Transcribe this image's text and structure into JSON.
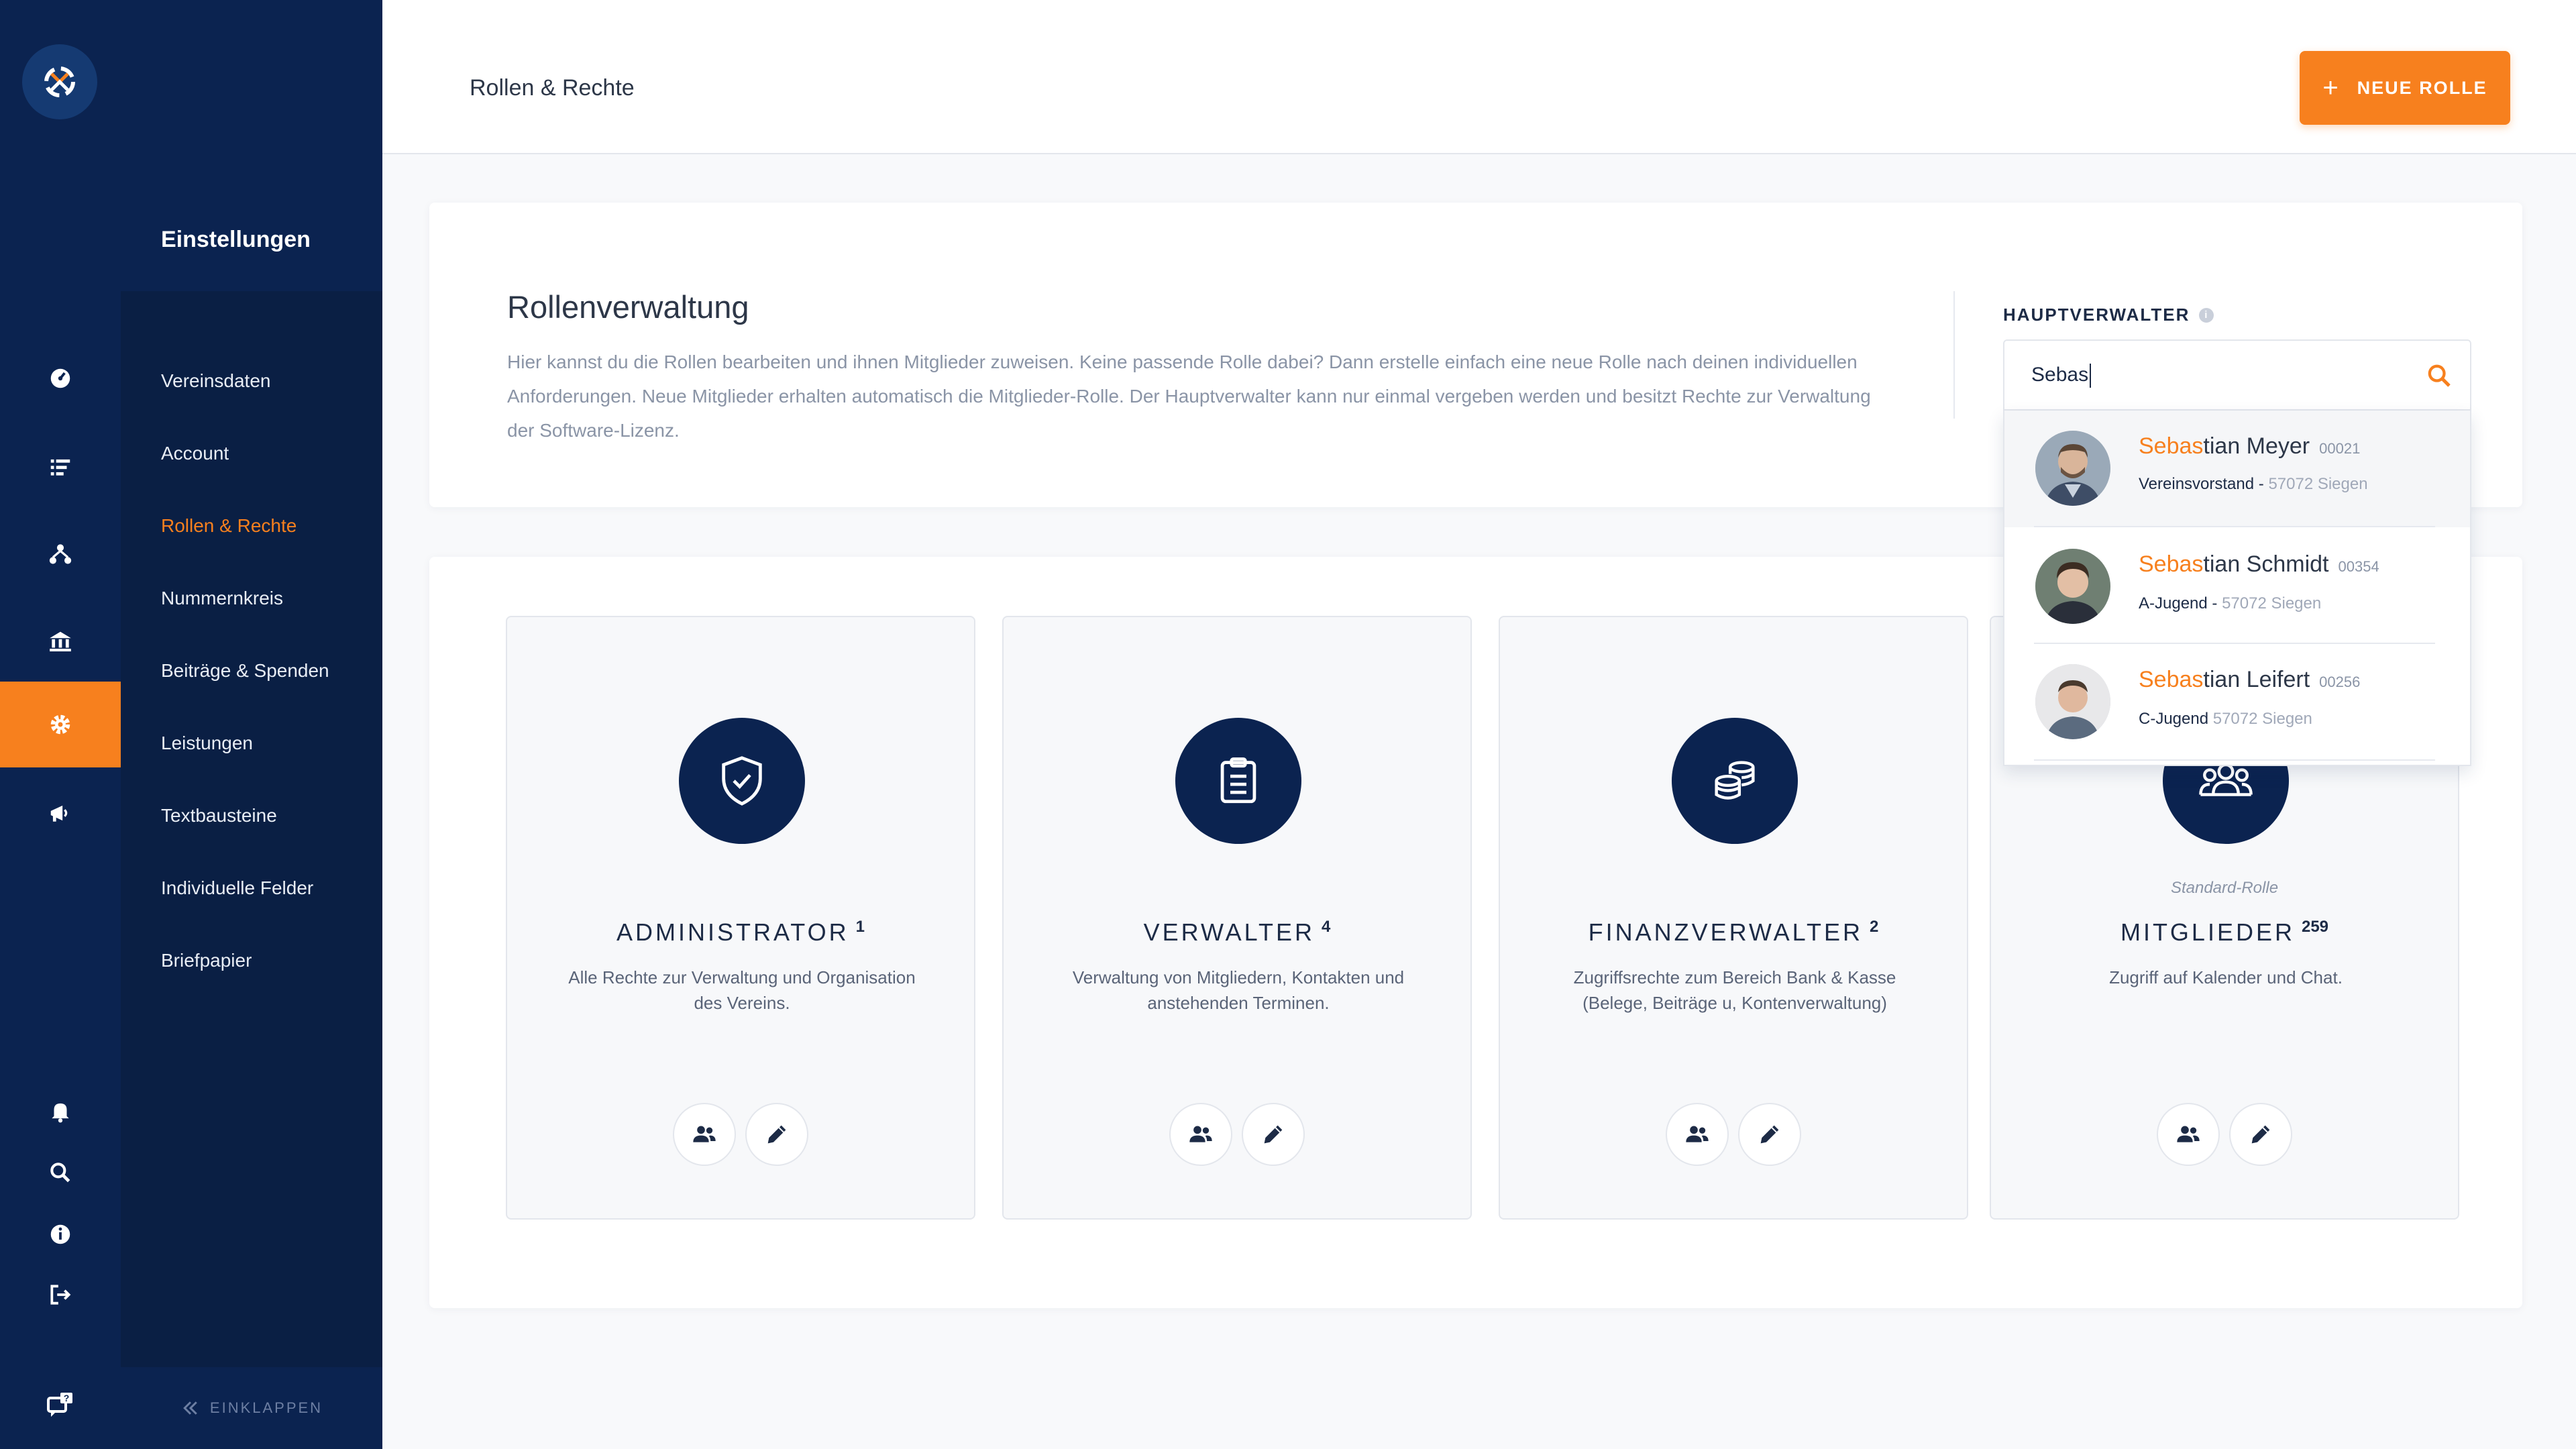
{
  "rail": {
    "logo_icon": "club-logo-icon",
    "items": [
      {
        "icon": "dashboard-icon"
      },
      {
        "icon": "list-icon"
      },
      {
        "icon": "network-icon"
      },
      {
        "icon": "bank-icon"
      },
      {
        "icon": "gear-icon"
      },
      {
        "icon": "megaphone-icon"
      },
      {
        "icon": "bell-icon"
      },
      {
        "icon": "search-icon"
      },
      {
        "icon": "info-icon"
      },
      {
        "icon": "logout-icon"
      },
      {
        "icon": "help-chat-icon"
      }
    ]
  },
  "sidebar": {
    "title": "Einstellungen",
    "items": [
      {
        "label": "Vereinsdaten"
      },
      {
        "label": "Account"
      },
      {
        "label": "Rollen & Rechte"
      },
      {
        "label": "Nummernkreis"
      },
      {
        "label": "Beiträge & Spenden"
      },
      {
        "label": "Leistungen"
      },
      {
        "label": "Textbausteine"
      },
      {
        "label": "Individuelle Felder"
      },
      {
        "label": "Briefpapier"
      }
    ],
    "collapse_label": "EINKLAPPEN"
  },
  "header": {
    "breadcrumb": "Rollen & Rechte",
    "new_role_label": "NEUE ROLLE"
  },
  "info": {
    "title": "Rollenverwaltung",
    "text": "Hier kannst du die Rollen bearbeiten und ihnen Mitglieder zuweisen. Keine passende Rolle dabei? Dann erstelle einfach eine neue Rolle nach deinen individuellen Anforderungen. Neue Mitglieder erhalten automatisch die Mitglieder-Rolle. Der Hauptverwalter kann nur einmal vergeben werden und besitzt Rechte zur Verwaltung der Software-Lizenz.",
    "main_admin_label": "HAUPTVERWALTER"
  },
  "search": {
    "value": "Sebas",
    "results": [
      {
        "name_match": "Sebas",
        "name_rest": "tian Meyer",
        "id": "00021",
        "role": "Vereinsvorstand",
        "separator": " - ",
        "location": "57072 Siegen"
      },
      {
        "name_match": "Sebas",
        "name_rest": "tian Schmidt",
        "id": "00354",
        "role": "A-Jugend",
        "separator": " - ",
        "location": "57072 Siegen"
      },
      {
        "name_match": "Sebas",
        "name_rest": "tian Leifert",
        "id": "00256",
        "role": "C-Jugend",
        "separator": " ",
        "location": "57072 Siegen"
      }
    ]
  },
  "roles": [
    {
      "name": "ADMINISTRATOR",
      "count": "1",
      "icon": "shield-check-icon",
      "standard": "",
      "description": "Alle Rechte zur Verwaltung und Organisation des Vereins."
    },
    {
      "name": "VERWALTER",
      "count": "4",
      "icon": "clipboard-icon",
      "standard": "",
      "description": "Verwaltung von Mitgliedern, Kontakten und anstehenden Terminen."
    },
    {
      "name": "FINANZVERWALTER",
      "count": "2",
      "icon": "coins-icon",
      "standard": "",
      "description": "Zugriffsrechte zum Bereich Bank & Kasse (Belege, Beiträge u, Kontenverwaltung)"
    },
    {
      "name": "MITGLIEDER",
      "count": "259",
      "icon": "group-icon",
      "standard": "Standard-Rolle",
      "description": "Zugriff auf Kalender und Chat."
    }
  ],
  "colors": {
    "accent": "#f7801e",
    "navy": "#0b2350",
    "sidebar": "#0a1f44"
  }
}
